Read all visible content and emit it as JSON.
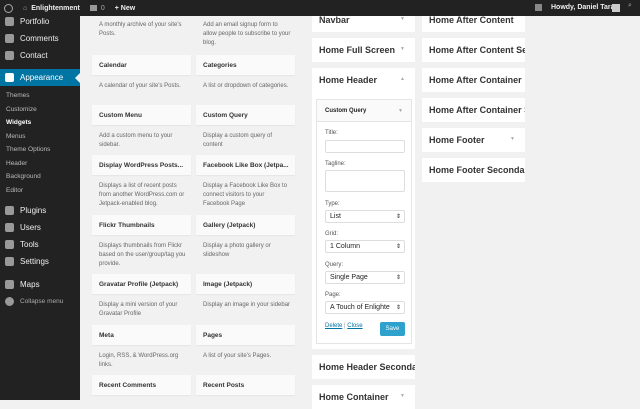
{
  "adminbar": {
    "site": "Enlightenment",
    "comments": "0",
    "new": "+ New",
    "howdy": "Howdy, Daniel Tara"
  },
  "menu": {
    "top": [
      "Portfolio",
      "Comments",
      "Contact"
    ],
    "active": "Appearance",
    "sub": [
      "Themes",
      "Customize",
      "Widgets",
      "Menus",
      "Theme Options",
      "Header",
      "Background",
      "Editor"
    ],
    "bottom": [
      "Plugins",
      "Users",
      "Tools",
      "Settings"
    ],
    "maps": "Maps",
    "collapse": "Collapse menu"
  },
  "widgets": {
    "top_desc": [
      "A monthly archive of your site's Posts.",
      "Add an email signup form to allow people to subscribe to your blog."
    ],
    "rows": [
      {
        "a": {
          "t": "Calendar",
          "d": "A calendar of your site's Posts."
        },
        "b": {
          "t": "Categories",
          "d": "A list or dropdown of categories."
        }
      },
      {
        "a": {
          "t": "Custom Menu",
          "d": "Add a custom menu to your sidebar."
        },
        "b": {
          "t": "Custom Query",
          "d": "Display a custom query of content"
        }
      },
      {
        "a": {
          "t": "Display WordPress Posts...",
          "d": "Displays a list of recent posts from another WordPress.com or Jetpack-enabled blog."
        },
        "b": {
          "t": "Facebook Like Box (Jetpa...",
          "d": "Display a Facebook Like Box to connect visitors to your Facebook Page"
        }
      },
      {
        "a": {
          "t": "Flickr Thumbnails",
          "d": "Displays thumbnails from Flickr based on the user/group/tag you provide."
        },
        "b": {
          "t": "Gallery (Jetpack)",
          "d": "Display a photo gallery or slideshow"
        }
      },
      {
        "a": {
          "t": "Gravatar Profile (Jetpack)",
          "d": "Display a mini version of your Gravatar Profile"
        },
        "b": {
          "t": "Image (Jetpack)",
          "d": "Display an image in your sidebar"
        }
      },
      {
        "a": {
          "t": "Meta",
          "d": "Login, RSS, & WordPress.org links."
        },
        "b": {
          "t": "Pages",
          "d": "A list of your site's Pages."
        }
      },
      {
        "a": {
          "t": "Recent Comments",
          "d": ""
        },
        "b": {
          "t": "Recent Posts",
          "d": ""
        }
      }
    ]
  },
  "sidebars_left": [
    "Navbar",
    "Home Full Screen",
    "Home Header",
    "Home Header Seconda",
    "Home Container"
  ],
  "sidebars_right": [
    "Home After Content",
    "Home After Content Se",
    "Home After Container",
    "Home After Container S",
    "Home Footer",
    "Home Footer Secondar"
  ],
  "form": {
    "widget": "Custom Query",
    "title_label": "Title:",
    "title_value": "",
    "tagline_label": "Tagline:",
    "tagline_value": "",
    "type_label": "Type:",
    "type_value": "List",
    "grid_label": "Grid:",
    "grid_value": "1 Column",
    "query_label": "Query:",
    "query_value": "Single Page",
    "page_label": "Page:",
    "page_value": "A Touch of Enlighte",
    "delete": "Delete",
    "sep": "|",
    "close": "Close",
    "save": "Save"
  },
  "colors": {
    "accent": "#0074a2",
    "save": "#2ea2cc"
  }
}
